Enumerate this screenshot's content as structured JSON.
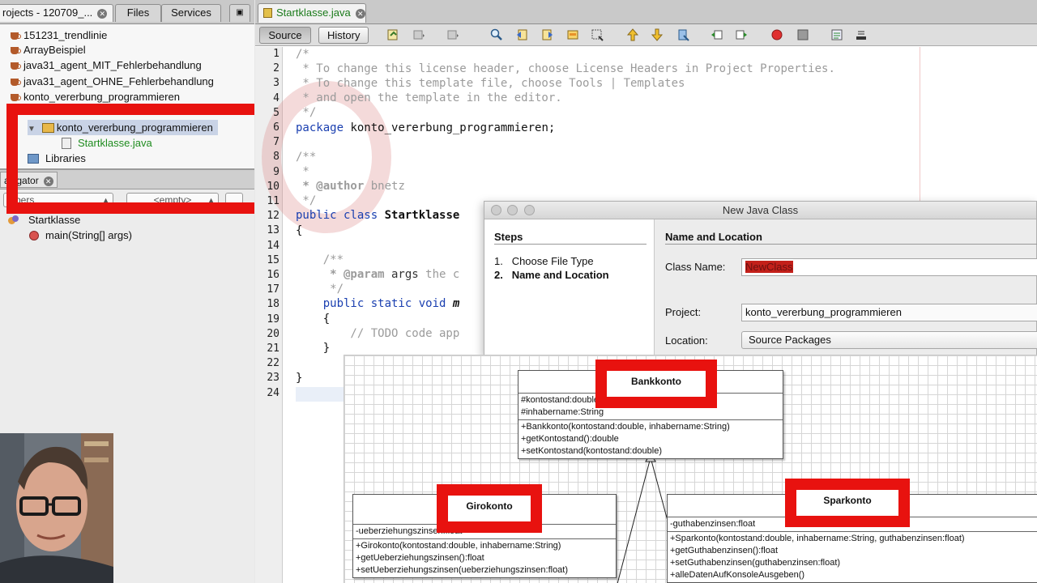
{
  "left_panel": {
    "tabs": [
      {
        "label": "rojects - 120709_..."
      },
      {
        "label": "Files"
      },
      {
        "label": "Services"
      }
    ],
    "projects": [
      "151231_trendlinie",
      "ArrayBeispiel",
      "java31_agent_MIT_Fehlerbehandlung",
      "java31_agent_OHNE_Fehlerbehandlung",
      "konto_vererbung_programmieren"
    ],
    "package_name": "konto_vererbung_programmieren",
    "java_file": "Startklasse.java",
    "libraries": "Libraries",
    "navigator": {
      "tab_label": "avigator",
      "members_combo": "mbers",
      "filter_combo": "<empty>",
      "class_name": "Startklasse",
      "method": "main(String[] args)"
    }
  },
  "editor": {
    "tab_label": "Startklasse.java",
    "source_button": "Source",
    "history_button": "History",
    "line_numbers": [
      "1",
      "2",
      "3",
      "4",
      "5",
      "6",
      "7",
      "8",
      "9",
      "10",
      "11",
      "12",
      "13",
      "14",
      "15",
      "16",
      "17",
      "18",
      "19",
      "20",
      "21",
      "22",
      "23",
      "24"
    ],
    "code": {
      "l1": "/*",
      "l2": " * To change this license header, choose License Headers in Project Properties.",
      "l3": " * To change this template file, choose Tools | Templates",
      "l4": " * and open the template in the editor.",
      "l5": " */",
      "l6_kw": "package",
      "l6_rest": " konto_vererbung_programmieren;",
      "l8": "/**",
      "l9": " *",
      "l10_a": " * @author",
      "l10_b": " bnetz",
      "l11": " */",
      "l12_kw": "public class",
      "l12_name": " Startklasse",
      "l13": "{",
      "l15": "    /**",
      "l16_a": "     * @param",
      "l16_b": " args",
      "l16_c": " the c",
      "l17": "     */",
      "l18_kw": "    public static void",
      "l18_rest": " m",
      "l19": "    {",
      "l20": "        // TODO code app",
      "l21": "    }",
      "l23": "}"
    }
  },
  "dialog": {
    "title": "New Java Class",
    "steps_heading": "Steps",
    "steps": [
      {
        "num": "1.",
        "label": "Choose File Type"
      },
      {
        "num": "2.",
        "label": "Name and Location"
      }
    ],
    "section_heading": "Name and Location",
    "class_name_label": "Class Name:",
    "class_name_value": "NewClass",
    "project_label": "Project:",
    "project_value": "konto_vererbung_programmieren",
    "location_label": "Location:",
    "location_value": "Source Packages"
  },
  "uml": {
    "bankkonto": {
      "name": "Bankkonto",
      "attributes": [
        "#kontostand:double",
        "#inhabername:String"
      ],
      "methods": [
        "+Bankkonto(kontostand:double, inhabername:String)",
        "+getKontostand():double",
        "+setKontostand(kontostand:double)"
      ]
    },
    "girokonto": {
      "name": "Girokonto",
      "attributes": [
        "-ueberziehungszinsen:float"
      ],
      "methods": [
        "+Girokonto(kontostand:double, inhabername:String)",
        "+getUeberziehungszinsen():float",
        "+setUeberziehungszinsen(ueberziehungszinsen:float)"
      ]
    },
    "sparkonto": {
      "name": "Sparkonto",
      "attributes": [
        "-guthabenzinsen:float"
      ],
      "methods": [
        "+Sparkonto(kontostand:double, inhabername:String, guthabenzinsen:float)",
        "+getGuthabenzinsen():float",
        "+setGuthabenzinsen(guthabenzinsen:float)",
        "+alleDatenAufKonsoleAusgeben()"
      ]
    }
  },
  "colors": {
    "highlight_red": "#e8120f",
    "keyword_blue": "#1a3fb0",
    "comment_gray": "#9b9b9b",
    "file_green": "#1f8c1f"
  },
  "icons": {
    "project": "coffee-cup-icon",
    "package": "package-icon",
    "java_file": "java-file-icon",
    "libraries": "libraries-icon",
    "class": "class-icon",
    "method": "method-icon"
  }
}
